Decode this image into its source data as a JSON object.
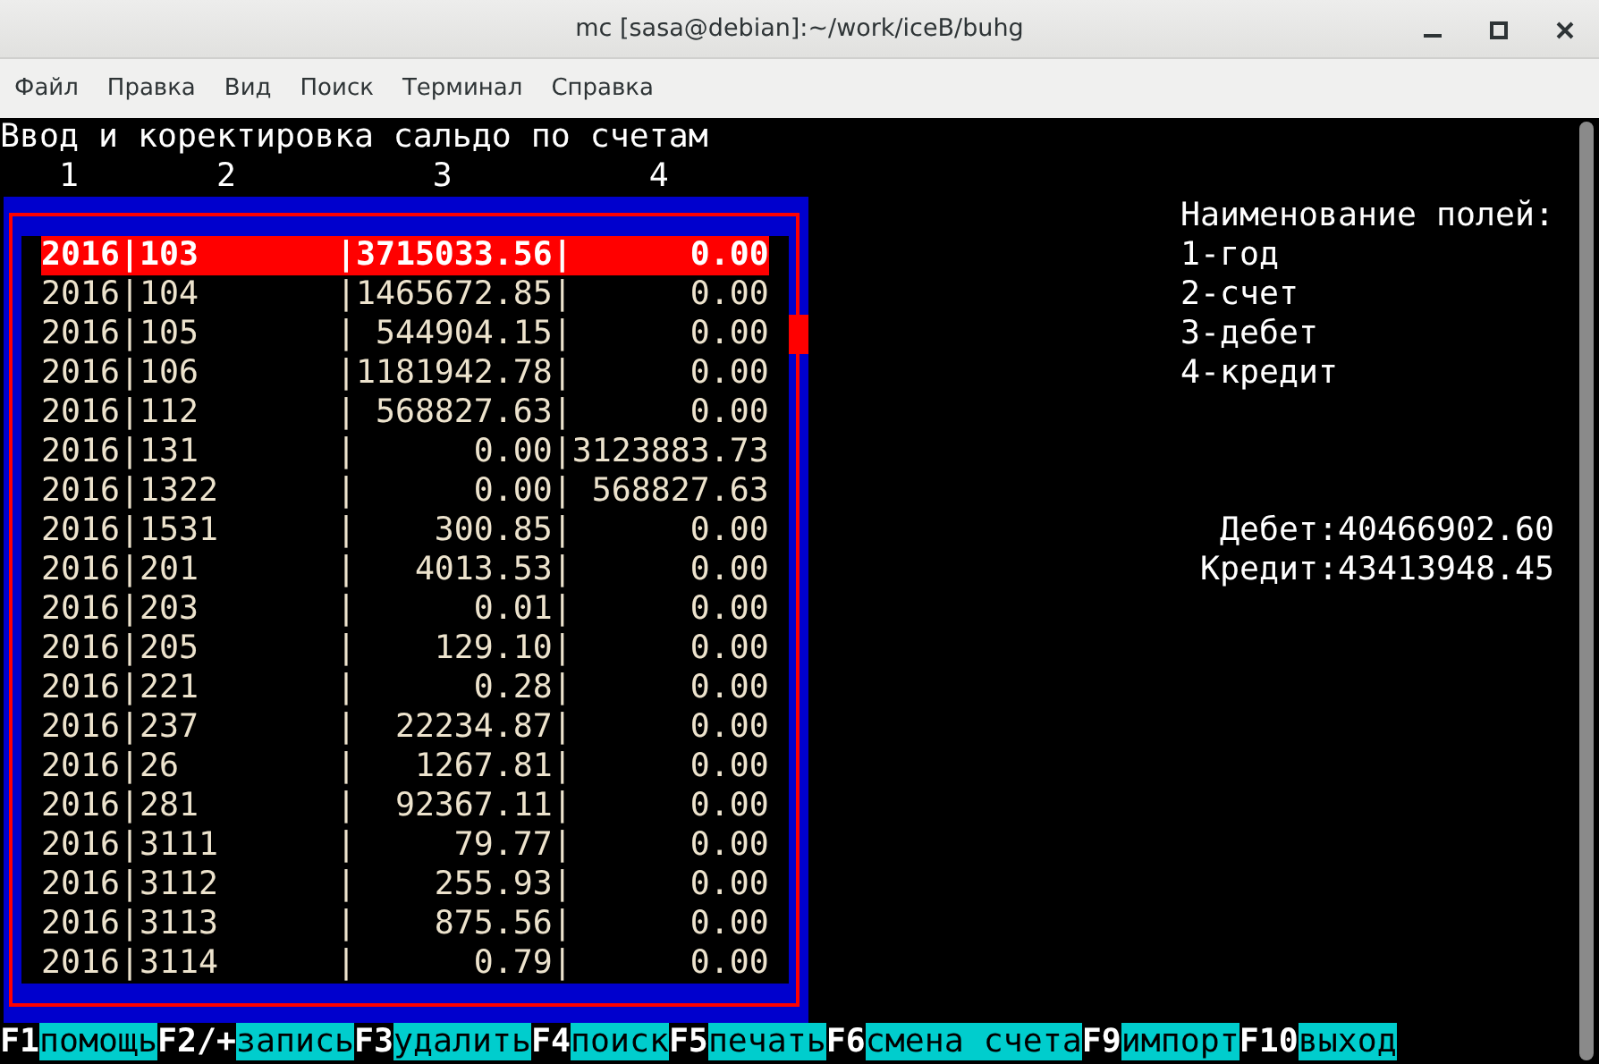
{
  "window": {
    "title": "mc [sasa@debian]:~/work/iceB/buhg"
  },
  "menu": [
    "Файл",
    "Правка",
    "Вид",
    "Поиск",
    "Терминал",
    "Справка"
  ],
  "terminal": {
    "heading": "Ввод и коректировка сальдо по счетам",
    "column_numbers": [
      "1",
      "2",
      "3",
      "4"
    ],
    "rows": [
      {
        "line": "2016|103       |3715033.56|      0.00",
        "selected": true
      },
      {
        "line": "2016|104       |1465672.85|      0.00",
        "selected": false
      },
      {
        "line": "2016|105       | 544904.15|      0.00",
        "selected": false
      },
      {
        "line": "2016|106       |1181942.78|      0.00",
        "selected": false
      },
      {
        "line": "2016|112       | 568827.63|      0.00",
        "selected": false
      },
      {
        "line": "2016|131       |      0.00|3123883.73",
        "selected": false
      },
      {
        "line": "2016|1322      |      0.00| 568827.63",
        "selected": false
      },
      {
        "line": "2016|1531      |    300.85|      0.00",
        "selected": false
      },
      {
        "line": "2016|201       |   4013.53|      0.00",
        "selected": false
      },
      {
        "line": "2016|203       |      0.01|      0.00",
        "selected": false
      },
      {
        "line": "2016|205       |    129.10|      0.00",
        "selected": false
      },
      {
        "line": "2016|221       |      0.28|      0.00",
        "selected": false
      },
      {
        "line": "2016|237       |  22234.87|      0.00",
        "selected": false
      },
      {
        "line": "2016|26        |   1267.81|      0.00",
        "selected": false
      },
      {
        "line": "2016|281       |  92367.11|      0.00",
        "selected": false
      },
      {
        "line": "2016|3111      |     79.77|      0.00",
        "selected": false
      },
      {
        "line": "2016|3112      |    255.93|      0.00",
        "selected": false
      },
      {
        "line": "2016|3113      |    875.56|      0.00",
        "selected": false
      },
      {
        "line": "2016|3114      |      0.79|      0.00",
        "selected": false
      }
    ],
    "legend": [
      "Наименование полей:",
      "1-год",
      "2-счет",
      "3-дебет",
      "4-кредит"
    ],
    "totals": [
      "Дебет:40466902.60",
      "Кредит:43413948.45"
    ],
    "function_keys": [
      {
        "key": "F1",
        "label": "помощь"
      },
      {
        "key": "F2/+",
        "label": "запись"
      },
      {
        "key": "F3",
        "label": "удалить"
      },
      {
        "key": "F4",
        "label": "поиск"
      },
      {
        "key": "F5",
        "label": "печать"
      },
      {
        "key": "F6",
        "label": "смена счета"
      },
      {
        "key": "F9",
        "label": "импорт"
      },
      {
        "key": "F10",
        "label": "выход"
      }
    ]
  }
}
